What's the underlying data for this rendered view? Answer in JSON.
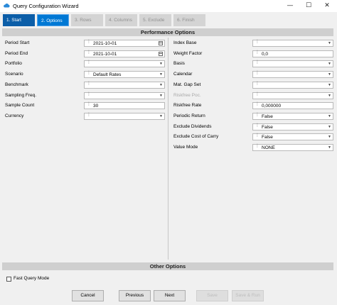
{
  "window": {
    "title": "Query Configuration Wizard",
    "minimize": "—",
    "maximize": "☐",
    "close": "✕"
  },
  "steps": [
    "1. Start",
    "2. Options",
    "3. Rows",
    "4. Columns",
    "5. Exclude",
    "6. Finish"
  ],
  "sections": {
    "performance": "Performance Options",
    "other": "Other Options"
  },
  "left_fields": [
    {
      "label": "Period Start",
      "value": "2021-10-01",
      "kind": "date"
    },
    {
      "label": "Period End",
      "value": "2021-10-01",
      "kind": "date"
    },
    {
      "label": "Portfolio",
      "value": "",
      "kind": "select"
    },
    {
      "label": "Scenario",
      "value": "Default Rates",
      "kind": "select"
    },
    {
      "label": "Benchmark",
      "value": "",
      "kind": "select"
    },
    {
      "label": "Sampling Freq.",
      "value": "",
      "kind": "select"
    },
    {
      "label": "Sample Count",
      "value": "30",
      "kind": "text"
    },
    {
      "label": "Currency",
      "value": "",
      "kind": "select"
    }
  ],
  "right_fields": [
    {
      "label": "Index Base",
      "value": "",
      "kind": "select"
    },
    {
      "label": "Weight Factor",
      "value": "0,0",
      "kind": "text"
    },
    {
      "label": "Basis",
      "value": "",
      "kind": "select"
    },
    {
      "label": "Calendar",
      "value": "",
      "kind": "select"
    },
    {
      "label": "Mat. Gap Set",
      "value": "",
      "kind": "select"
    },
    {
      "label": "Riskfree Poc.",
      "value": "",
      "kind": "select",
      "disabled": true
    },
    {
      "label": "Riskfree Rate",
      "value": "0,000000",
      "kind": "text"
    },
    {
      "label": "Periodic Return",
      "value": "False",
      "kind": "select"
    },
    {
      "label": "Exclude Dividends",
      "value": "False",
      "kind": "select"
    },
    {
      "label": "Exclude Cost of Carry",
      "value": "False",
      "kind": "select"
    },
    {
      "label": "Value Mode",
      "value": "NONE",
      "kind": "select"
    }
  ],
  "fast_query": {
    "label": "Fast Query Mode",
    "checked": false
  },
  "buttons": {
    "cancel": "Cancel",
    "previous": "Previous",
    "next": "Next",
    "save": "Save",
    "save_run": "Save & Run"
  }
}
